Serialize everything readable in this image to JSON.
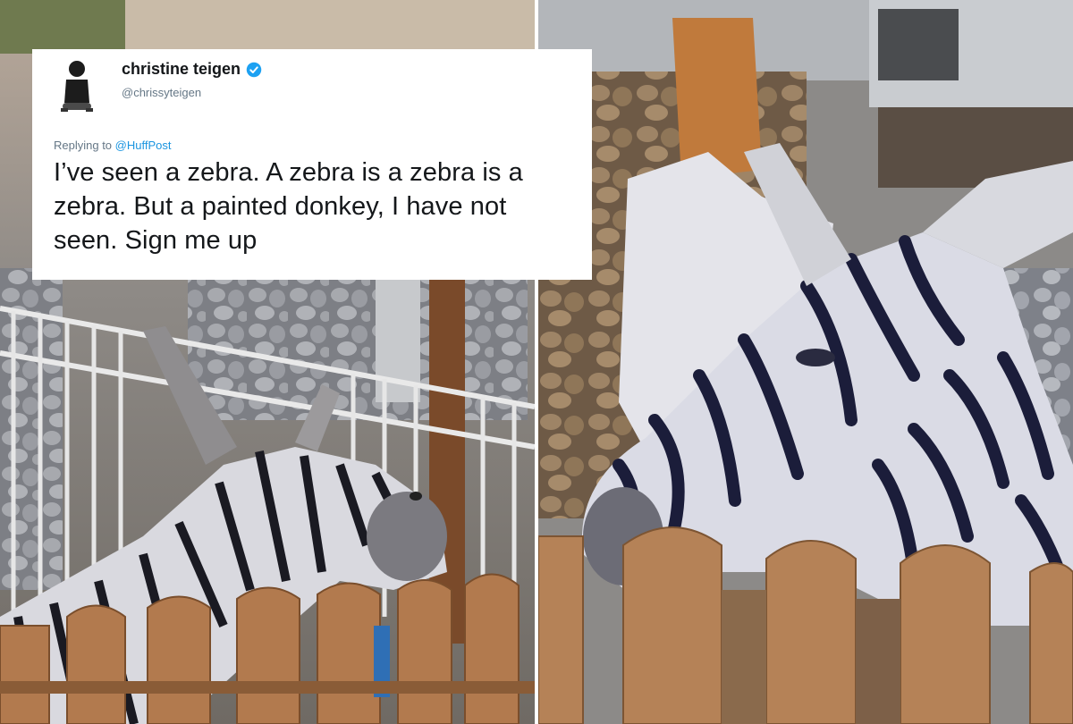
{
  "tweet": {
    "display_name": "christine teigen",
    "handle": "@chrissyteigen",
    "replying_prefix": "Replying to",
    "replying_to": "@HuffPost",
    "text": "I’ve seen a zebra. A zebra is a zebra is a zebra. But a painted donkey, I have not seen. Sign me up",
    "verified": true,
    "accent_color": "#1b95e0"
  },
  "photos": [
    {
      "subject": "painted donkey behind railing and wooden fence"
    },
    {
      "subject": "close-up of painted donkey over wooden fence"
    }
  ]
}
